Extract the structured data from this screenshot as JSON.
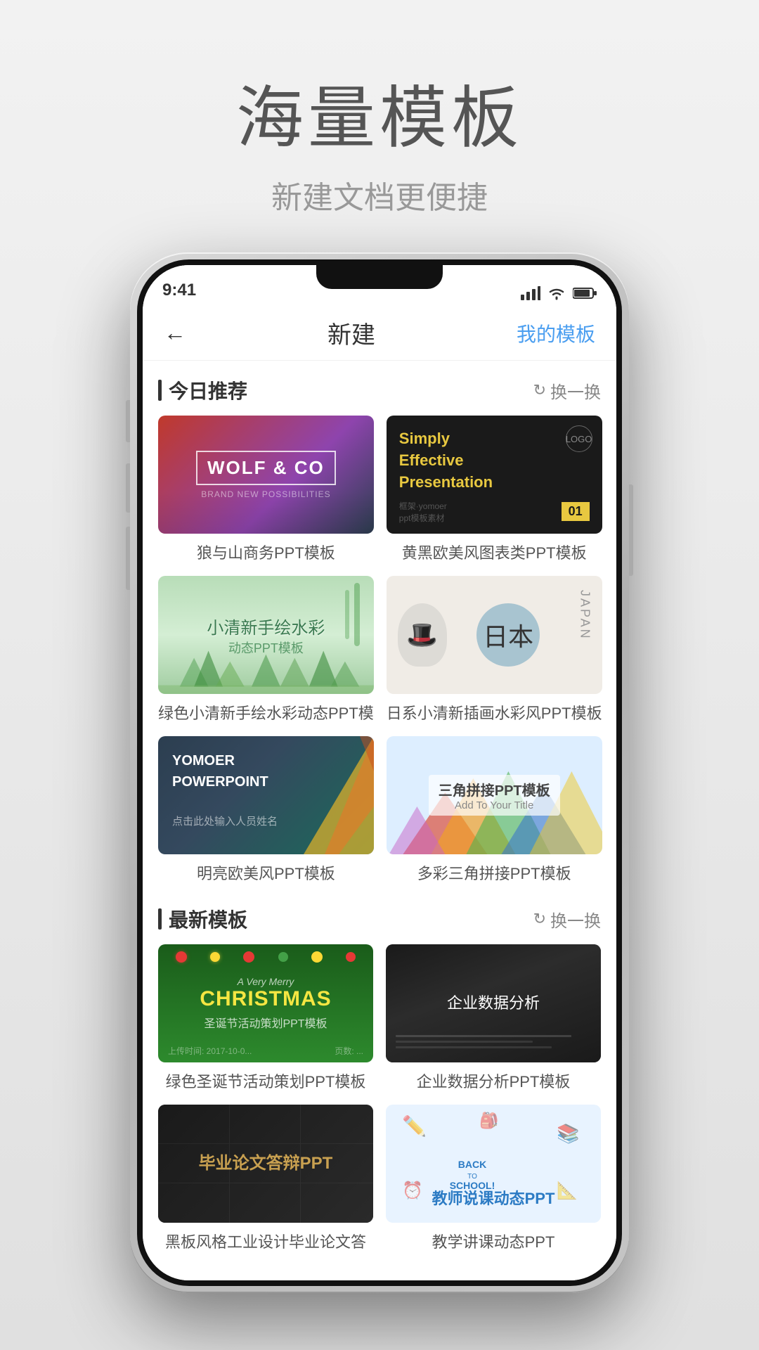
{
  "page": {
    "title": "海量模板",
    "subtitle": "新建文档更便捷"
  },
  "nav": {
    "back_icon": "←",
    "title": "新建",
    "action_label": "我的模板",
    "my_templates_label": "我的模板"
  },
  "sections": [
    {
      "id": "recommended",
      "title": "今日推荐",
      "refresh_label": "换一换",
      "templates": [
        {
          "id": "wolf",
          "title": "WOLF & CO",
          "subtitle": "BRAND NEW POSSIBILITIES",
          "label": "狼与山商务PPT模板",
          "type": "wolf"
        },
        {
          "id": "simple",
          "title": "Simply\nEffective\nPresentation",
          "logo_text": "LOGO",
          "number": "01",
          "label": "黄黑欧美风图表类PPT模板",
          "type": "simple"
        },
        {
          "id": "watercolor",
          "title": "小清新手绘水彩",
          "subtitle": "动态PPT模板",
          "label": "绿色小清新手绘水彩动态PPT模",
          "type": "watercolor"
        },
        {
          "id": "japan",
          "title": "日本",
          "label": "日系小清新插画水彩风PPT模板",
          "type": "japan"
        },
        {
          "id": "yomoer",
          "title": "YOMOER\nPOWERPOINT",
          "subtitle": "点击此处输入人员姓名",
          "label": "明亮欧美风PPT模板",
          "type": "yomoer"
        },
        {
          "id": "triangle",
          "title": "三角拼接PPT模板",
          "subtitle": "Add To Your Title",
          "label": "多彩三角拼接PPT模板",
          "type": "triangle"
        }
      ]
    },
    {
      "id": "latest",
      "title": "最新模板",
      "refresh_label": "换一换",
      "templates": [
        {
          "id": "christmas",
          "title": "A Very Merry\nCHRISTMAS",
          "subtitle": "圣诞节活动策划PPT模板",
          "label": "绿色圣诞节活动策划PPT模板",
          "type": "christmas"
        },
        {
          "id": "bizdata",
          "title": "企业数据分析",
          "label": "企业数据分析PPT模板",
          "type": "bizdata"
        },
        {
          "id": "graduation",
          "title": "毕业论文答辩PPT",
          "label": "黑板风格工业设计毕业论文答",
          "type": "graduation"
        },
        {
          "id": "teacher",
          "title": "教师说课动态PPT",
          "label": "教学讲课动态PPT",
          "type": "teacher"
        }
      ]
    }
  ],
  "icons": {
    "refresh": "↻",
    "back": "←"
  }
}
